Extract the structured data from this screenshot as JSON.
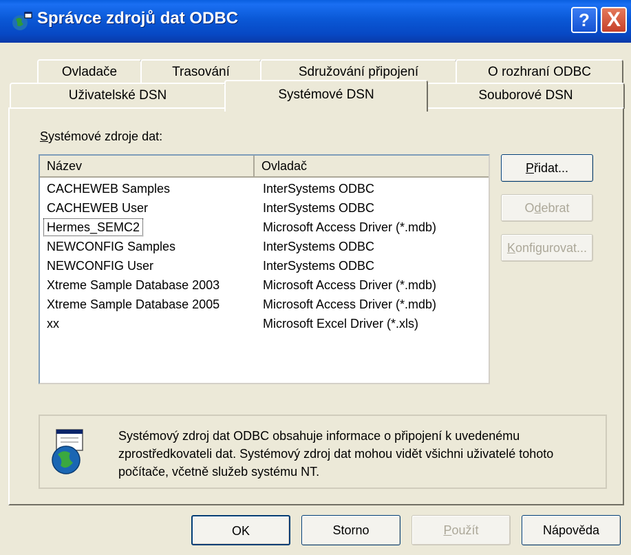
{
  "window": {
    "title": "Správce zdrojů dat ODBC",
    "help_glyph": "?",
    "close_glyph": "X"
  },
  "tabs_back": [
    "Ovladače",
    "Trasování",
    "Sdružování připojení",
    "O rozhraní ODBC"
  ],
  "tabs_front": [
    "Uživatelské DSN",
    "Systémové DSN",
    "Souborové DSN"
  ],
  "active_tab": "Systémové DSN",
  "group_label": {
    "accel": "S",
    "rest": "ystémové zdroje dat:"
  },
  "list": {
    "columns": [
      "Název",
      "Ovladač"
    ],
    "rows": [
      {
        "name": "CACHEWEB Samples",
        "driver": "InterSystems ODBC"
      },
      {
        "name": "CACHEWEB User",
        "driver": "InterSystems ODBC"
      },
      {
        "name": "Hermes_SEMC2",
        "driver": "Microsoft Access Driver (*.mdb)"
      },
      {
        "name": "NEWCONFIG Samples",
        "driver": "InterSystems ODBC"
      },
      {
        "name": "NEWCONFIG User",
        "driver": "InterSystems ODBC"
      },
      {
        "name": "Xtreme Sample Database 2003",
        "driver": "Microsoft Access Driver (*.mdb)"
      },
      {
        "name": "Xtreme Sample Database 2005",
        "driver": "Microsoft Access Driver (*.mdb)"
      },
      {
        "name": "xx",
        "driver": "Microsoft Excel Driver (*.xls)"
      }
    ],
    "focused_row": "Hermes_SEMC2"
  },
  "buttons": {
    "add": {
      "accel": "P",
      "rest": "řidat..."
    },
    "remove": {
      "pre": "O",
      "accel": "d",
      "rest": "ebrat"
    },
    "configure": {
      "accel": "K",
      "rest": "onfigurovat..."
    },
    "ok": "OK",
    "cancel": "Storno",
    "apply": {
      "accel": "P",
      "rest": "oužít"
    },
    "help": "Nápověda"
  },
  "info": {
    "text": "Systémový zdroj dat ODBC obsahuje informace o připojení k uvedenému zprostředkovateli dat. Systémový zdroj dat mohou vidět všichni uživatelé tohoto počítače, včetně služeb systému NT."
  },
  "colors": {
    "titlebar": "#0a58d6",
    "dialog_bg": "#ece9d8",
    "close_button": "#c6402a",
    "disabled_text": "#aca899"
  }
}
